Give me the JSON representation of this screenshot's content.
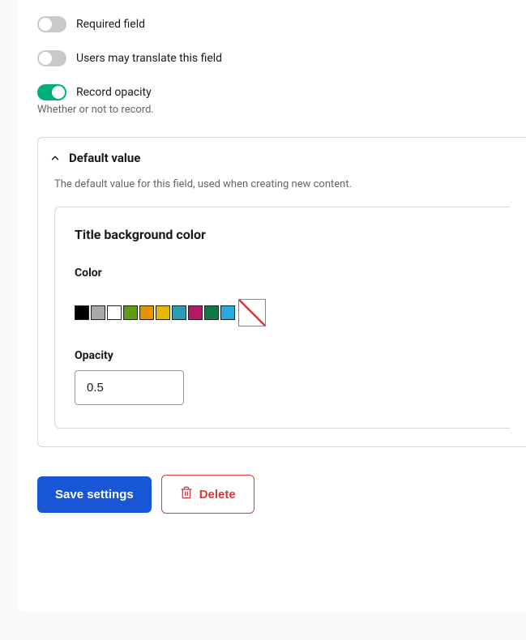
{
  "toggles": {
    "required": {
      "label": "Required field",
      "value": false
    },
    "translate": {
      "label": "Users may translate this field",
      "value": false
    },
    "recordOpacity": {
      "label": "Record opacity",
      "value": true,
      "helper": "Whether or not to record."
    }
  },
  "defaultValue": {
    "header": "Default value",
    "description": "The default value for this field, used when creating new content.",
    "fieldset": {
      "title": "Title background color",
      "colorLabel": "Color",
      "swatches": [
        "#000000",
        "#a9a9a9",
        "#ffffff",
        "#609a16",
        "#e99200",
        "#e4b700",
        "#2a9db4",
        "#b41a62",
        "#0d7a3f",
        "#2aa9e0"
      ],
      "opacityLabel": "Opacity",
      "opacityValue": "0.5"
    }
  },
  "actions": {
    "save": "Save settings",
    "delete": "Delete"
  }
}
